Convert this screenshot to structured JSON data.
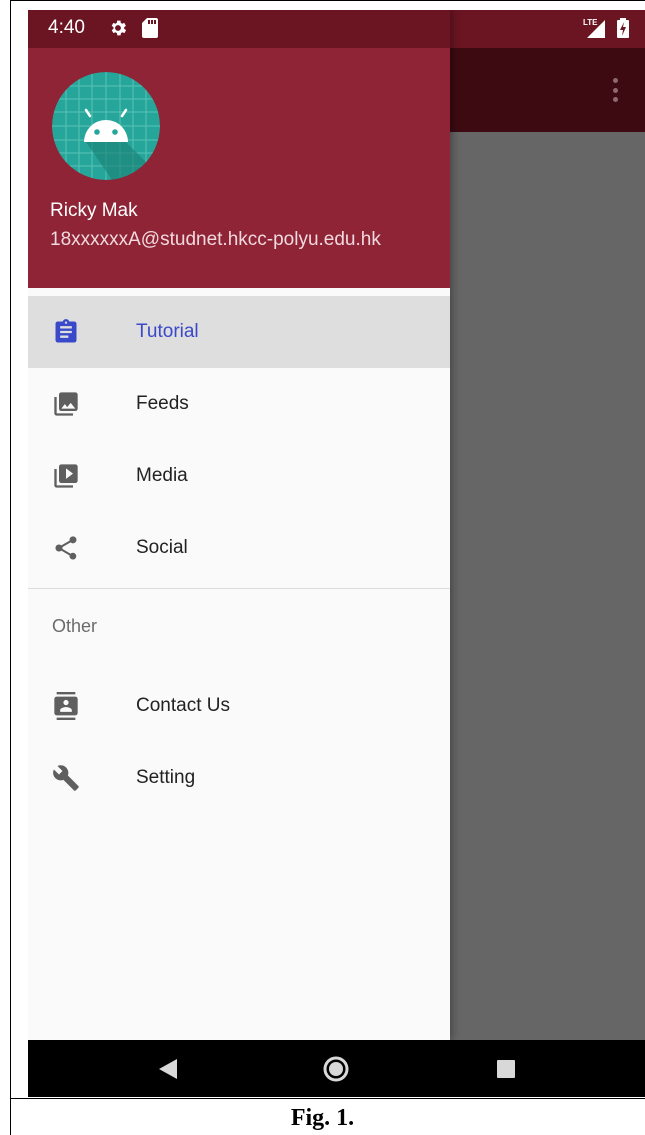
{
  "status_bar": {
    "time": "4:40",
    "network_label": "LTE"
  },
  "header": {
    "user_name": "Ricky Mak",
    "user_email": "18xxxxxxA@studnet.hkcc-polyu.edu.hk"
  },
  "menu": {
    "items": [
      {
        "label": "Tutorial",
        "icon": "clipboard-icon",
        "selected": true
      },
      {
        "label": "Feeds",
        "icon": "photo-library-icon",
        "selected": false
      },
      {
        "label": "Media",
        "icon": "video-library-icon",
        "selected": false
      },
      {
        "label": "Social",
        "icon": "share-icon",
        "selected": false
      }
    ],
    "section_title": "Other",
    "other_items": [
      {
        "label": "Contact Us",
        "icon": "contact-icon"
      },
      {
        "label": "Setting",
        "icon": "wrench-icon"
      }
    ]
  },
  "colors": {
    "primary": "#8e2436",
    "primary_dark": "#6b1422",
    "accent": "#3949c9",
    "scrim": "#666666"
  },
  "caption": "Fig. 1."
}
